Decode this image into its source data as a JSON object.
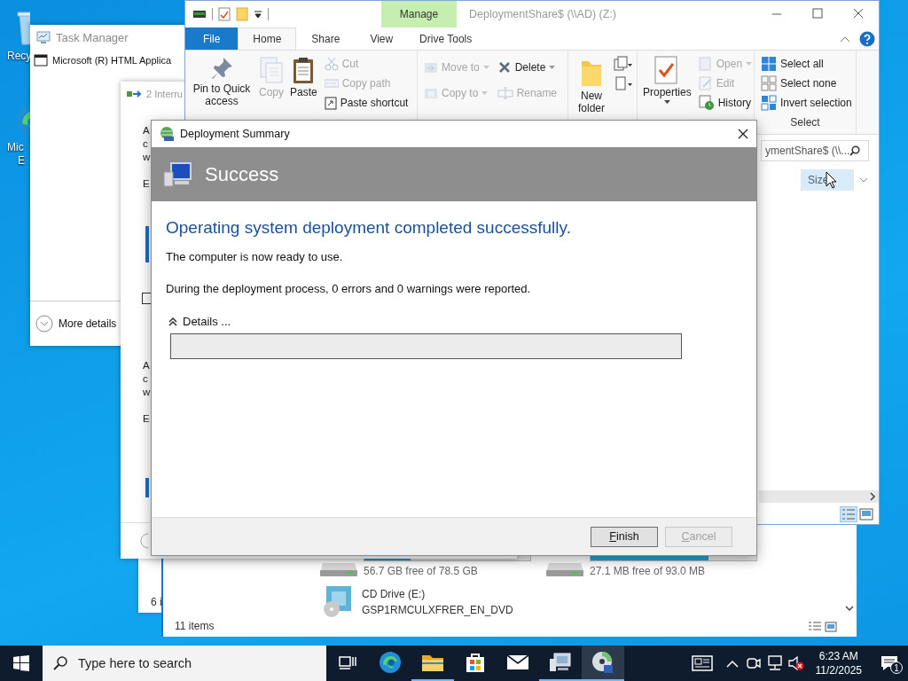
{
  "desktop": {
    "icons": [
      {
        "kind": "bin",
        "lines": [
          "Recy"
        ]
      },
      {
        "kind": "browser",
        "lines": [
          "Mic",
          "E"
        ]
      }
    ]
  },
  "task_manager": {
    "title": "Task Manager",
    "apps": [
      "Microsoft (R) HTML Applica"
    ],
    "more_details": "More details"
  },
  "back_window": {
    "status": "6 i"
  },
  "interrupt_window": {
    "title": "2 Interru",
    "fragments_top": [
      "A",
      "c",
      "w",
      "E"
    ],
    "fragments_bottom": [
      "A",
      "c",
      "w",
      "E"
    ],
    "checkbox": {
      "checked": false
    }
  },
  "drives_window": {
    "drives": [
      {
        "kind": "disk",
        "free": "56.7 GB free of 78.5 GB",
        "level": 0.28
      },
      {
        "kind": "disk",
        "free": "27.1 MB free of 93.0 MB",
        "level": 0.71
      },
      {
        "kind": "cd",
        "name": "CD Drive (E:)",
        "label": "GSP1RMCULXFRER_EN_DVD"
      }
    ],
    "status": "11 items"
  },
  "explorer": {
    "title": "DeploymentShare$ (\\\\AD) (Z:)",
    "context_tab": "Manage",
    "tabs": [
      {
        "label": "File",
        "kind": "file",
        "selected": false
      },
      {
        "label": "Home",
        "kind": "tab",
        "selected": true
      },
      {
        "label": "Share",
        "kind": "tab",
        "selected": false
      },
      {
        "label": "View",
        "kind": "tab",
        "selected": false
      },
      {
        "label": "Drive Tools",
        "kind": "tab",
        "selected": false
      }
    ],
    "ribbon": [
      {
        "items": [
          {
            "kind": "large",
            "label": "Pin to Quick access",
            "disabled": false
          },
          {
            "kind": "large",
            "label": "Copy",
            "disabled": true
          },
          {
            "kind": "large",
            "label": "Paste",
            "disabled": false
          },
          {
            "kind": "stack",
            "items": [
              {
                "label": "Cut",
                "disabled": true
              },
              {
                "label": "Copy path",
                "disabled": true
              },
              {
                "label": "Paste shortcut",
                "disabled": false
              }
            ]
          }
        ]
      },
      {
        "items": [
          {
            "kind": "stack2",
            "items": [
              {
                "label": "Move to",
                "disabled": true,
                "dropdown": true
              },
              {
                "label": "Copy to",
                "disabled": true,
                "dropdown": true
              }
            ]
          },
          {
            "kind": "stack2",
            "items": [
              {
                "label": "Delete",
                "disabled": false,
                "dropdown": true
              },
              {
                "label": "Rename",
                "disabled": true
              }
            ]
          }
        ]
      },
      {
        "items": [
          {
            "kind": "large",
            "label": "New folder",
            "disabled": false
          },
          {
            "kind": "new-icons"
          }
        ]
      },
      {
        "items": [
          {
            "kind": "large",
            "label": "Properties",
            "disabled": false,
            "dropdown": true
          },
          {
            "kind": "stack",
            "items": [
              {
                "label": "Open",
                "disabled": true,
                "dropdown": true
              },
              {
                "label": "Edit",
                "disabled": true
              },
              {
                "label": "History",
                "disabled": false
              }
            ]
          }
        ]
      },
      {
        "label": "Select",
        "items": [
          {
            "kind": "stack",
            "items": [
              {
                "label": "Select all",
                "disabled": false
              },
              {
                "label": "Select none",
                "disabled": false
              },
              {
                "label": "Invert selection",
                "disabled": false
              }
            ]
          }
        ]
      }
    ],
    "search": {
      "placeholder": "ymentShare$ (\\\\..."
    },
    "columns": [
      {
        "label": "Size",
        "highlighted": true
      }
    ]
  },
  "dialog": {
    "title": "Deployment Summary",
    "banner": "Success",
    "heading": "Operating system deployment completed successfully.",
    "paragraphs": [
      "The computer is now ready to use.",
      "During the deployment process, 0 errors and 0 warnings were reported."
    ],
    "details": {
      "label": "Details ...",
      "expanded": true
    },
    "buttons": [
      {
        "label": "Finish",
        "disabled": false
      },
      {
        "label": "Cancel",
        "disabled": true
      }
    ]
  },
  "taskbar": {
    "search": {
      "placeholder": "Type here to search"
    },
    "apps": [
      {
        "kind": "task-view",
        "open": false,
        "selected": false
      },
      {
        "kind": "browser",
        "open": false,
        "selected": false
      },
      {
        "kind": "folder",
        "open": true,
        "selected": false
      },
      {
        "kind": "store",
        "open": false,
        "selected": false
      },
      {
        "kind": "mail",
        "open": false,
        "selected": false
      },
      {
        "kind": "computer",
        "open": true,
        "selected": false
      },
      {
        "kind": "disc",
        "open": true,
        "selected": true
      }
    ],
    "tray": [
      {
        "kind": "news"
      },
      {
        "kind": "chevron"
      },
      {
        "kind": "meeting"
      },
      {
        "kind": "network"
      },
      {
        "kind": "volume-muted"
      }
    ],
    "clock": {
      "time": "6:23 AM",
      "date": "11/2/2025"
    },
    "notifications": {
      "count": "1"
    }
  }
}
